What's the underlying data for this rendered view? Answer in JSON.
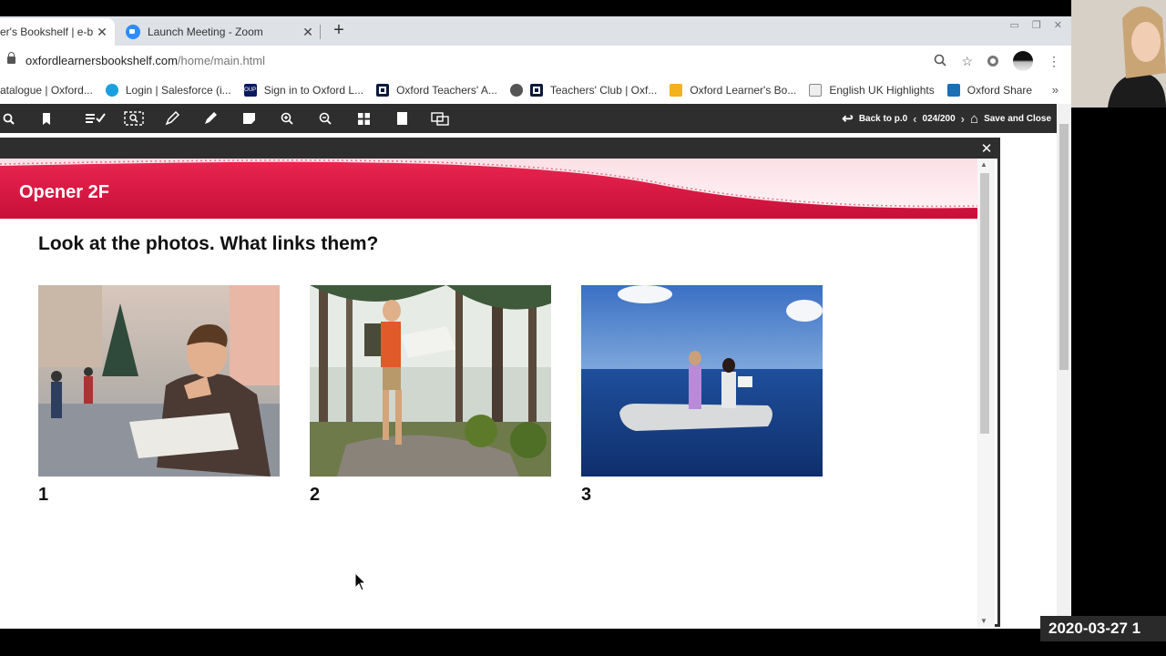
{
  "browser": {
    "tabs": [
      {
        "title": "er's Bookshelf | e-b",
        "active": true
      },
      {
        "title": "Launch Meeting - Zoom",
        "active": false
      }
    ],
    "url_domain": "oxfordlearnersbookshelf.com",
    "url_path": "/home/main.html",
    "bookmarks": [
      {
        "label": "atalogue | Oxford...",
        "icon": "none"
      },
      {
        "label": "Login | Salesforce (i...",
        "icon": "salesforce-cloud-icon"
      },
      {
        "label": "Sign in to Oxford L...",
        "icon": "oup-icon",
        "icon_text": "OUP"
      },
      {
        "label": "Oxford Teachers' A...",
        "icon": "oxford-o-icon"
      },
      {
        "label": "Teachers' Club | Oxf...",
        "icon": "globe-o-icon"
      },
      {
        "label": "Oxford Learner's Bo...",
        "icon": "bookshelf-icon"
      },
      {
        "label": "English UK Highlights",
        "icon": "highlights-icon"
      },
      {
        "label": "Oxford Share",
        "icon": "share-icon"
      }
    ]
  },
  "reader": {
    "back_label": "Back to p.0",
    "page_counter": "024/200",
    "save_close_label": "Save and Close",
    "tools": [
      "search-icon",
      "bookmark-icon",
      "checklist-icon",
      "select-area-icon",
      "pencil-icon",
      "highlighter-icon",
      "note-icon",
      "zoom-in-icon",
      "zoom-out-icon",
      "grid-icon",
      "page-icon",
      "copy-icon"
    ]
  },
  "page": {
    "section_title": "Opener 2F",
    "question": "Look at the photos. What links them?",
    "photos": [
      {
        "number": "1",
        "subject": "man-reading-map-in-city"
      },
      {
        "number": "2",
        "subject": "hiker-reading-map-in-forest"
      },
      {
        "number": "3",
        "subject": "people-in-dinghy-at-sea"
      }
    ]
  },
  "overlay": {
    "timestamp": "2020-03-27  1"
  },
  "colors": {
    "banner_red": "#d3123e",
    "toolbar_dark": "#2e2e2e",
    "sea_blue": "#1a4f9c"
  }
}
